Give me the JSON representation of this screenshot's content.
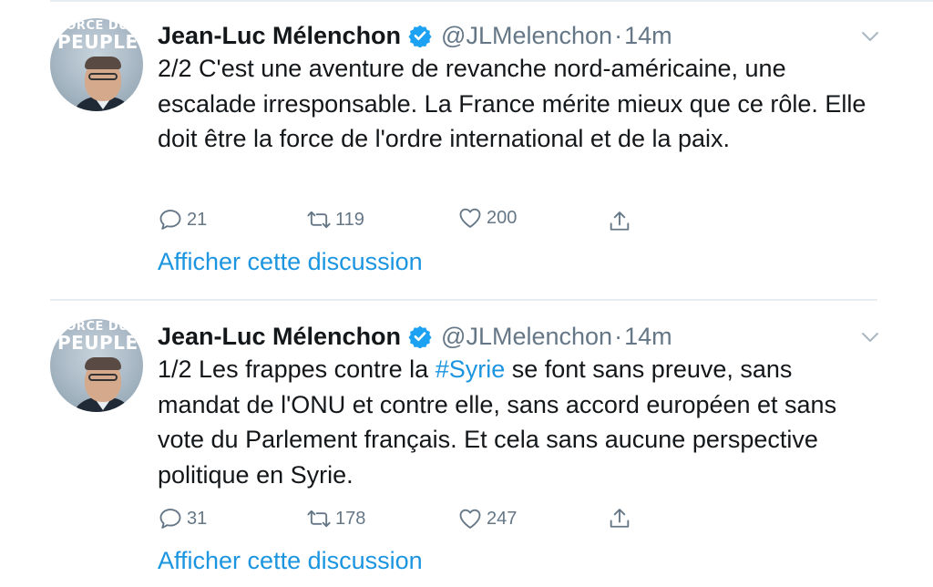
{
  "tweets": [
    {
      "author_name": "Jean-Luc Mélenchon",
      "handle": "@JLMelenchon",
      "separator": "·",
      "time": "14m",
      "avatar_banner_line1": "FORCE DU",
      "avatar_banner_line2": "PEUPLE",
      "text": "2/2 C'est une aventure de revanche nord-américaine, une escalade irresponsable. La France mérite mieux que ce rôle. Elle doit être la force de l'ordre international et de la paix.",
      "replies": "21",
      "retweets": "119",
      "likes": "200",
      "thread_link": "Afficher cette discussion"
    },
    {
      "author_name": "Jean-Luc Mélenchon",
      "handle": "@JLMelenchon",
      "separator": "·",
      "time": "14m",
      "avatar_banner_line1": "FORCE DU",
      "avatar_banner_line2": "PEUPLE",
      "text_before": "1/2 Les frappes contre la ",
      "hashtag": "#Syrie",
      "text_after": " se font sans preuve, sans mandat de l'ONU et contre elle, sans accord européen et sans vote du Parlement français. Et cela sans aucune perspective politique en Syrie.",
      "replies": "31",
      "retweets": "178",
      "likes": "247",
      "thread_link": "Afficher cette discussion"
    }
  ],
  "icons": {
    "verified": "verified-badge-icon",
    "caret": "chevron-down-icon",
    "reply": "reply-icon",
    "retweet": "retweet-icon",
    "like": "heart-icon",
    "share": "share-icon"
  },
  "colors": {
    "link": "#1b95e0",
    "muted": "#657786",
    "text": "#14171a",
    "divider": "#e6ecf0"
  }
}
